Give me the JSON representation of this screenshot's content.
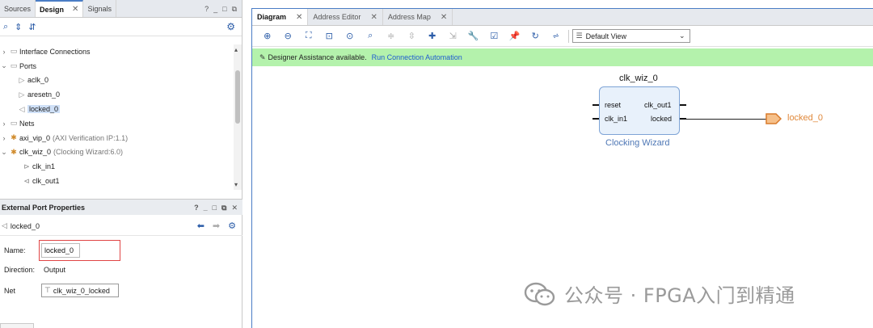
{
  "left": {
    "tabs": [
      {
        "label": "Sources"
      },
      {
        "label": "Design"
      },
      {
        "label": "Signals"
      }
    ],
    "window_controls": [
      "?",
      "_",
      "□",
      "⧉"
    ],
    "tree": [
      {
        "label": "Interface Connections",
        "level": 0,
        "arrow": "›",
        "icon": "folder-icon"
      },
      {
        "label": "Ports",
        "level": 0,
        "arrow": "⌄",
        "icon": "folder-icon"
      },
      {
        "label": "aclk_0",
        "level": 1,
        "icon": "input-port-icon"
      },
      {
        "label": "aresetn_0",
        "level": 1,
        "icon": "input-port-icon"
      },
      {
        "label": "locked_0",
        "level": 1,
        "icon": "output-port-icon",
        "selected": true
      },
      {
        "label": "Nets",
        "level": 0,
        "arrow": "›",
        "icon": "folder-icon"
      },
      {
        "label": "axi_vip_0",
        "extra": "(AXI Verification IP:1.1)",
        "level": 0,
        "arrow": "›",
        "icon": "ip-icon"
      },
      {
        "label": "clk_wiz_0",
        "extra": "(Clocking Wizard:6.0)",
        "level": 0,
        "arrow": "⌄",
        "icon": "ip-icon"
      },
      {
        "label": "clk_in1",
        "level": 2,
        "icon": "clock-in-icon"
      },
      {
        "label": "clk_out1",
        "level": 2,
        "icon": "clock-out-icon"
      }
    ],
    "props": {
      "title": "External Port Properties",
      "object_name": "locked_0",
      "name_label": "Name:",
      "name_value": "locked_0",
      "direction_label": "Direction:",
      "direction_value": "Output",
      "net_label": "Net",
      "net_value": "clk_wiz_0_locked"
    }
  },
  "right": {
    "tabs": [
      {
        "label": "Diagram"
      },
      {
        "label": "Address Editor"
      },
      {
        "label": "Address Map"
      }
    ],
    "view_select": "Default View",
    "assist_text": "Designer Assistance available.",
    "assist_link": "Run Connection Automation",
    "block": {
      "instance": "clk_wiz_0",
      "subtitle": "Clocking Wizard",
      "pins_left": [
        "reset",
        "clk_in1"
      ],
      "pins_right": [
        "clk_out1",
        "locked"
      ]
    },
    "port_label": "locked_0"
  },
  "watermark": "公众号 · FPGA入门到精通",
  "colors": {
    "assist_bg": "#b4f2ac",
    "block_fill": "#e8f1fb",
    "block_border": "#7ea4d6",
    "port_orange": "#e0883a",
    "link_blue": "#1f5bd0",
    "active_tab_border": "#4a7dc5"
  }
}
